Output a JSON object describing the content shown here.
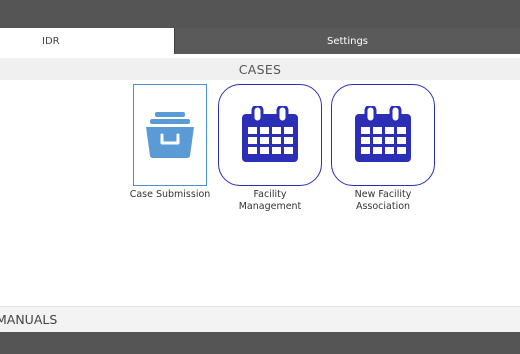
{
  "tabs": {
    "idr_label": "IDR",
    "settings_label": "Settings"
  },
  "cases": {
    "header": "CASES",
    "tiles": [
      {
        "label": "Case Submission",
        "icon": "file-drawer-icon"
      },
      {
        "label": "Facility Management",
        "icon": "calendar-icon"
      },
      {
        "label": "New Facility Association",
        "icon": "calendar-icon"
      }
    ]
  },
  "manuals": {
    "header": "MANUALS"
  },
  "colors": {
    "top_bar": "#555555",
    "icon_blue": "#5b9bd5",
    "calendar_blue": "#2b2fb8",
    "selected_border": "#4a90d9"
  }
}
